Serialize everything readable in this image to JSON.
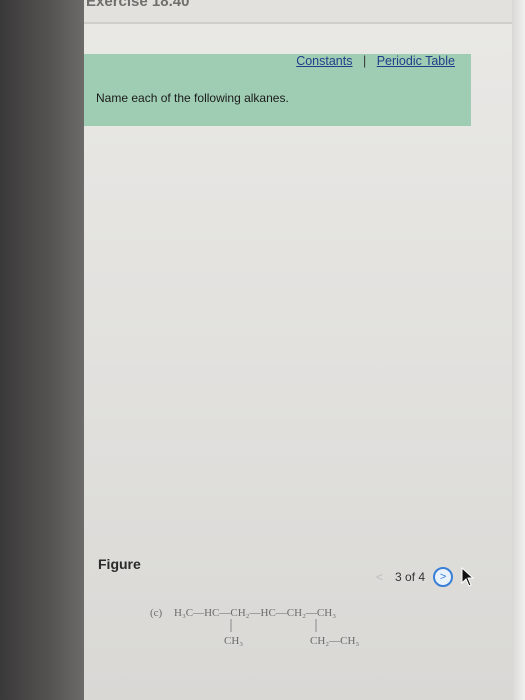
{
  "header": {
    "title": "Exercise 18.40"
  },
  "info": {
    "constants_link": "Constants",
    "separator": "|",
    "periodic_link": "Periodic Table",
    "prompt": "Name each of the following alkanes."
  },
  "figure": {
    "label": "Figure",
    "pager": {
      "prev_icon": "chevron-left",
      "status": "3 of 4",
      "next_icon": "chevron-right"
    },
    "structure": {
      "part": "(c)",
      "main_chain": "H₃C—HC—CH₂—HC—CH₂—CH₃",
      "branch_left": "CH₃",
      "branch_right": "CH₂—CH₃"
    }
  },
  "colors": {
    "panel": "#9fcdb3",
    "link": "#1f3f8a",
    "next_button": "#3a7fd6"
  }
}
